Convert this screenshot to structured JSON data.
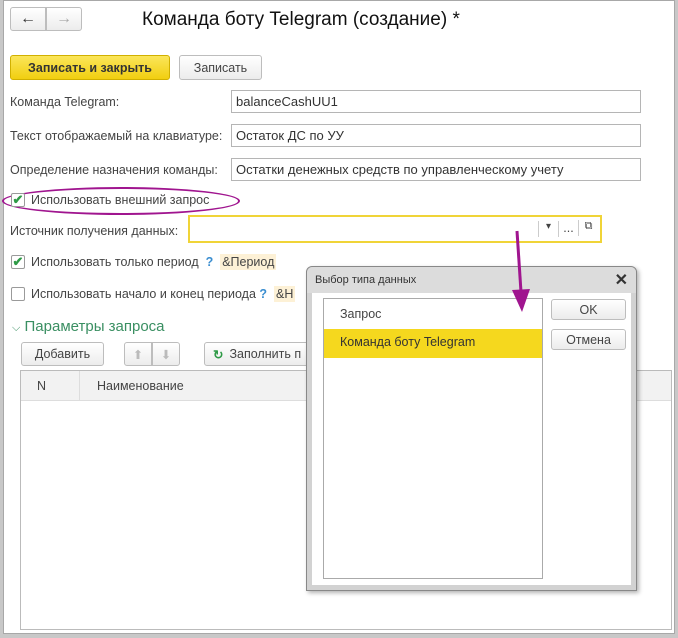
{
  "window": {
    "title": "Команда боту Telegram (создание) *"
  },
  "nav": {
    "back_icon": "←",
    "forward_icon": "→"
  },
  "toolbar": {
    "save_close": "Записать и закрыть",
    "save": "Записать"
  },
  "fields": [
    {
      "label": "Команда Telegram:",
      "value": "balanceCashUU1"
    },
    {
      "label": "Текст отображаемый на клавиатуре:",
      "value": "Остаток ДС по УУ"
    },
    {
      "label": "Определение назначения команды:",
      "value": "Остатки денежных средств по управленческому учету"
    }
  ],
  "use_external": {
    "label": "Использовать внешний запрос",
    "checked": true
  },
  "source": {
    "label": "Источник получения данных:",
    "value": "",
    "dropdown": "▾",
    "more": "...",
    "open": "⧉"
  },
  "only_period": {
    "label": "Использовать только период",
    "checked": true,
    "help": "?",
    "param": "&Период"
  },
  "start_end": {
    "label": "Использовать начало и конец периода",
    "checked": false,
    "help": "?",
    "param": "&Н"
  },
  "params": {
    "title": "Параметры запроса",
    "add": "Добавить",
    "fill": "Заполнить п",
    "columns": [
      "N",
      "Наименование"
    ]
  },
  "dialog": {
    "title": "Выбор типа данных",
    "items": [
      "Запрос",
      "Команда боту Telegram"
    ],
    "selected": 1,
    "ok": "OK",
    "cancel": "Отмена"
  },
  "colors": {
    "accent": "#f5d81e",
    "annotation": "#a0158f",
    "section": "#3a8f62"
  }
}
